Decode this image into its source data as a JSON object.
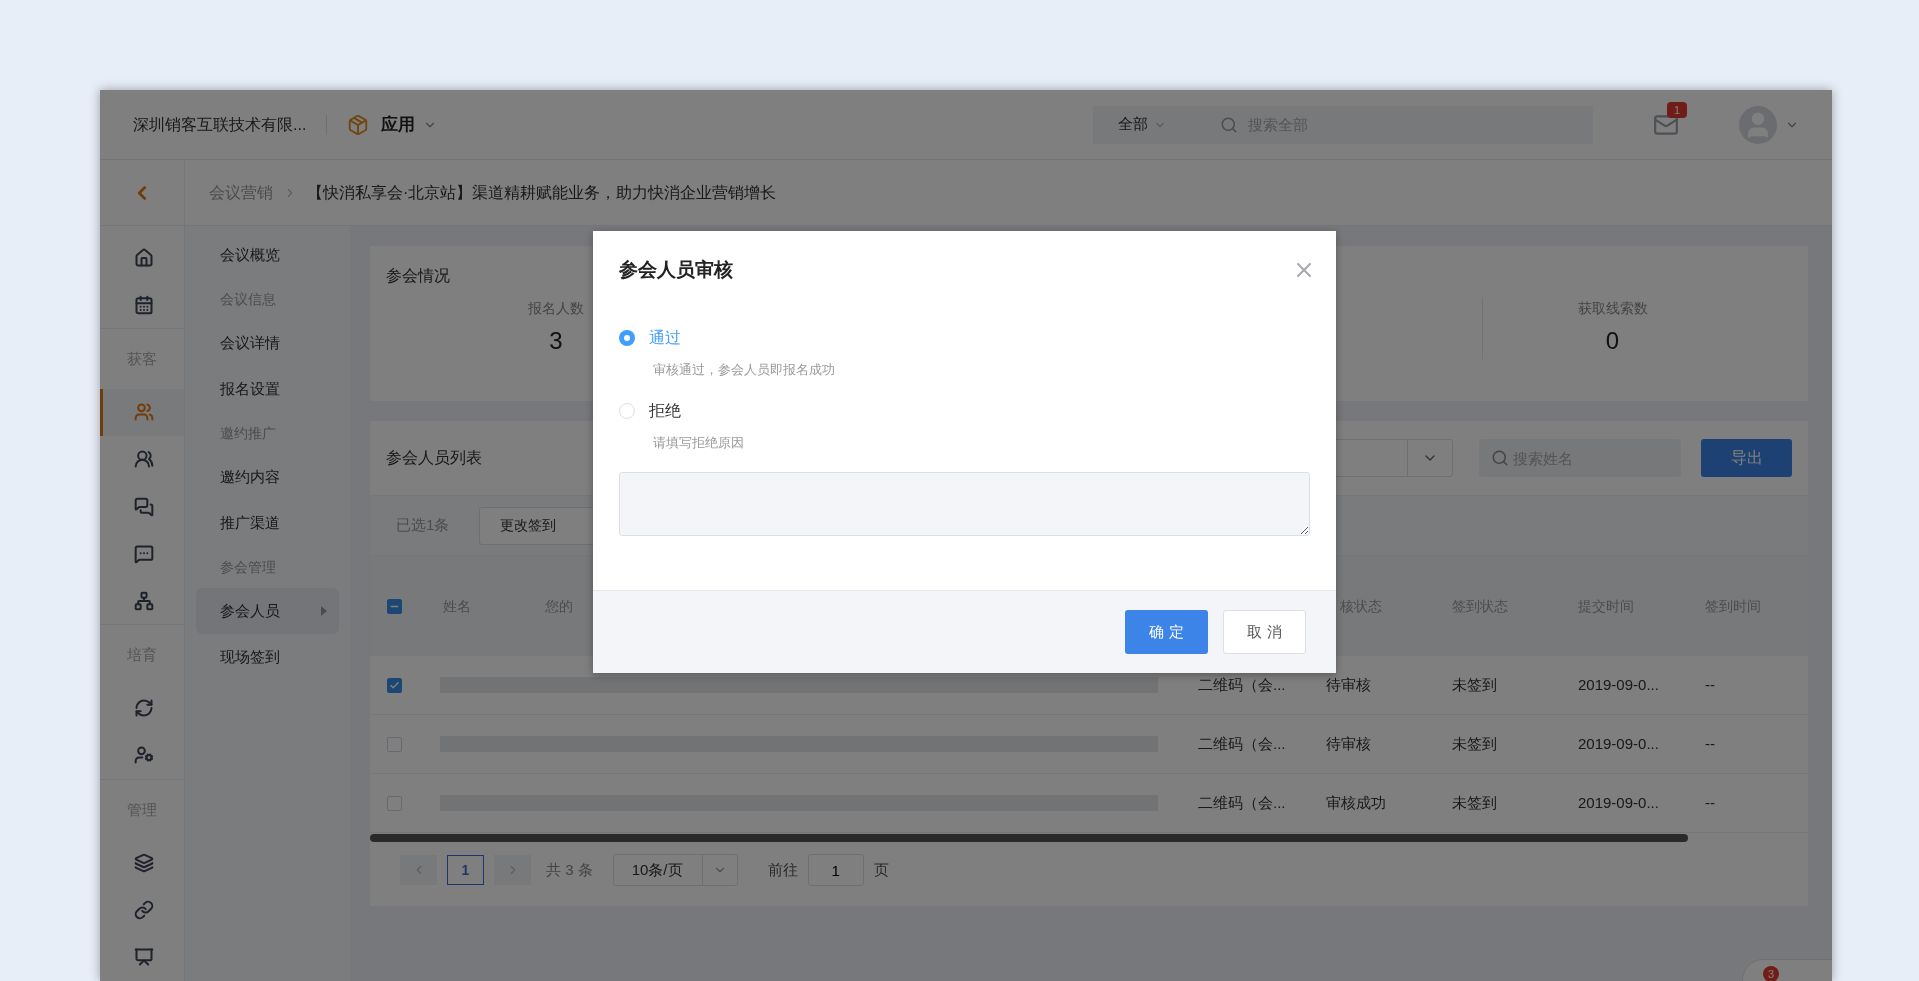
{
  "header": {
    "company": "深圳销客互联技术有限...",
    "app_menu": "应用",
    "search_scope": "全部",
    "search": {
      "placeholder": "搜索全部"
    },
    "mail_badge": "1"
  },
  "breadcrumb": [
    "会议营销",
    "【快消私享会·北京站】渠道精耕赋能业务，助力快消企业营销增长"
  ],
  "rail": [
    {
      "kind": "icon",
      "selected": false
    },
    {
      "kind": "icon",
      "selected": false
    },
    {
      "kind": "section",
      "label": "获客"
    },
    {
      "kind": "icon",
      "selected": true
    },
    {
      "kind": "icon",
      "selected": false
    },
    {
      "kind": "icon",
      "selected": false
    },
    {
      "kind": "icon",
      "selected": false
    },
    {
      "kind": "icon",
      "selected": false
    },
    {
      "kind": "section",
      "label": "培育"
    },
    {
      "kind": "icon",
      "selected": false
    },
    {
      "kind": "icon",
      "selected": false
    },
    {
      "kind": "section",
      "label": "管理"
    },
    {
      "kind": "icon",
      "selected": false
    },
    {
      "kind": "icon",
      "selected": false
    },
    {
      "kind": "icon",
      "selected": false
    }
  ],
  "submenu": [
    {
      "kind": "link",
      "label": "会议概览",
      "selected": false
    },
    {
      "kind": "heading",
      "label": "会议信息",
      "selected": false
    },
    {
      "kind": "link",
      "label": "会议详情",
      "selected": false
    },
    {
      "kind": "link",
      "label": "报名设置",
      "selected": false
    },
    {
      "kind": "heading",
      "label": "邀约推广",
      "selected": false
    },
    {
      "kind": "link",
      "label": "邀约内容",
      "selected": false
    },
    {
      "kind": "link",
      "label": "推广渠道",
      "selected": false
    },
    {
      "kind": "heading",
      "label": "参会管理",
      "selected": false
    },
    {
      "kind": "link",
      "label": "参会人员",
      "selected": true
    },
    {
      "kind": "link",
      "label": "现场签到",
      "selected": false
    }
  ],
  "stats": {
    "title": "参会情况",
    "items": [
      {
        "label": "报名人数",
        "value": "3"
      },
      {
        "label": "获取线索数",
        "value": "0"
      }
    ]
  },
  "list": {
    "title": "参会人员列表",
    "search": {
      "placeholder": "搜索姓名"
    },
    "export_button": "导出",
    "selected_count": "已选1条",
    "change_button": "更改签到",
    "select_all": {
      "indeterminate": true
    },
    "columns": [
      "姓名",
      "您的",
      "核状态",
      "签到状态",
      "提交时间",
      "签到时间"
    ],
    "rows": [
      {
        "checked": true,
        "source": "二维码（会...",
        "review": "待审核",
        "checkin": "未签到",
        "submitted": "2019-09-0...",
        "checkin_time": "--"
      },
      {
        "checked": false,
        "source": "二维码（会...",
        "review": "待审核",
        "checkin": "未签到",
        "submitted": "2019-09-0...",
        "checkin_time": "--"
      },
      {
        "checked": false,
        "source": "二维码（会...",
        "review": "审核成功",
        "checkin": "未签到",
        "submitted": "2019-09-0...",
        "checkin_time": "--"
      }
    ]
  },
  "pagination": {
    "pages": [
      {
        "label": "1",
        "selected": true
      }
    ],
    "total": "共 3 条",
    "page_size": "10条/页",
    "goto_label": "前往",
    "goto_value": "1",
    "goto_suffix": "页"
  },
  "chat_badge": "3",
  "dialog": {
    "title": "参会人员审核",
    "options": [
      {
        "label": "通过",
        "hint": "审核通过，参会人员即报名成功",
        "selected": true
      },
      {
        "label": "拒绝",
        "hint": "请填写拒绝原因",
        "selected": false
      }
    ],
    "buttons": [
      {
        "label": "确 定",
        "kind": "primary"
      },
      {
        "label": "取 消",
        "kind": "default"
      }
    ]
  }
}
